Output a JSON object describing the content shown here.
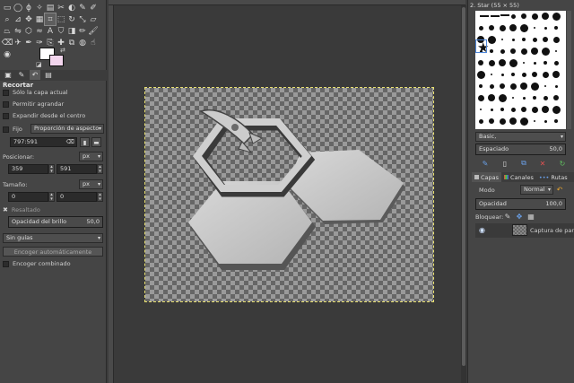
{
  "tools": [
    {
      "icon": "rect-select-icon",
      "glyph": "▭"
    },
    {
      "icon": "ellipse-select-icon",
      "glyph": "◯"
    },
    {
      "icon": "free-select-icon",
      "glyph": "ϕ"
    },
    {
      "icon": "fuzzy-select-icon",
      "glyph": "✧"
    },
    {
      "icon": "color-select-icon",
      "glyph": "▤"
    },
    {
      "icon": "scissors-icon",
      "glyph": "✂"
    },
    {
      "icon": "foreground-select-icon",
      "glyph": "◐"
    },
    {
      "icon": "paths-icon",
      "glyph": "✎"
    },
    {
      "icon": "color-picker-icon",
      "glyph": "✐"
    },
    {
      "icon": "zoom-icon",
      "glyph": "⌕"
    },
    {
      "icon": "measure-icon",
      "glyph": "⊿"
    },
    {
      "icon": "move-icon",
      "glyph": "✥"
    },
    {
      "icon": "align-icon",
      "glyph": "▦"
    },
    {
      "icon": "crop-icon",
      "glyph": "⌗"
    },
    {
      "icon": "unified-transform-icon",
      "glyph": "⬚"
    },
    {
      "icon": "rotate-icon",
      "glyph": "↻"
    },
    {
      "icon": "scale-icon",
      "glyph": "⤡"
    },
    {
      "icon": "shear-icon",
      "glyph": "▱"
    },
    {
      "icon": "perspective-icon",
      "glyph": "⏢"
    },
    {
      "icon": "flip-icon",
      "glyph": "⇋"
    },
    {
      "icon": "cage-icon",
      "glyph": "⬡"
    },
    {
      "icon": "warp-icon",
      "glyph": "≈"
    },
    {
      "icon": "text-icon",
      "glyph": "A"
    },
    {
      "icon": "bucket-fill-icon",
      "glyph": "⛉"
    },
    {
      "icon": "gradient-icon",
      "glyph": "◨"
    },
    {
      "icon": "pencil-icon",
      "glyph": "✏"
    },
    {
      "icon": "paintbrush-icon",
      "glyph": "🖌"
    },
    {
      "icon": "eraser-icon",
      "glyph": "⌫"
    },
    {
      "icon": "airbrush-icon",
      "glyph": "✈"
    },
    {
      "icon": "ink-icon",
      "glyph": "✒"
    },
    {
      "icon": "mypaint-brush-icon",
      "glyph": "✑"
    },
    {
      "icon": "clone-icon",
      "glyph": "⎘"
    },
    {
      "icon": "heal-icon",
      "glyph": "✚"
    },
    {
      "icon": "perspective-clone-icon",
      "glyph": "⧉"
    },
    {
      "icon": "blur-icon",
      "glyph": "◍"
    },
    {
      "icon": "smudge-icon",
      "glyph": "☝"
    },
    {
      "icon": "dodge-burn-icon",
      "glyph": "◉"
    }
  ],
  "colors": {
    "foreground": "#ffffff",
    "background": "#f3d6ee",
    "accent": "#4e86d8"
  },
  "tool_options": {
    "title": "Recortar",
    "current_layer_only": "Sólo la capa actual",
    "allow_growing": "Permitir agrandar",
    "expand_from_center": "Expandir desde el centro",
    "fixed_label": "Fijo",
    "fixed_mode": "Proporción de aspecto",
    "aspect_value": "797:591",
    "position_label": "Posicionar:",
    "position_unit": "px",
    "position_x": "359",
    "position_y": "591",
    "size_label": "Tamaño:",
    "size_unit": "px",
    "size_w": "0",
    "size_h": "0",
    "highlight_label": "Resaltado",
    "highlight_opacity_label": "Opacidad del brillo",
    "highlight_opacity_value": "50,0",
    "guides": "Sin guías",
    "autoshrink_button": "Encoger automáticamente",
    "shrink_merged": "Encoger combinado"
  },
  "brushes": {
    "header": "2. Star (55 × 55)",
    "tag_filter": "Basic,",
    "spacing_label": "Espaciado",
    "spacing_value": "50,0"
  },
  "layers": {
    "tabs": [
      "Capas",
      "Canales",
      "Rutas"
    ],
    "mode_label": "Modo",
    "mode_value": "Normal",
    "opacity_label": "Opacidad",
    "opacity_value": "100,0",
    "lock_label": "Bloquear:",
    "items": [
      {
        "name": "Captura de pantalla"
      }
    ]
  }
}
